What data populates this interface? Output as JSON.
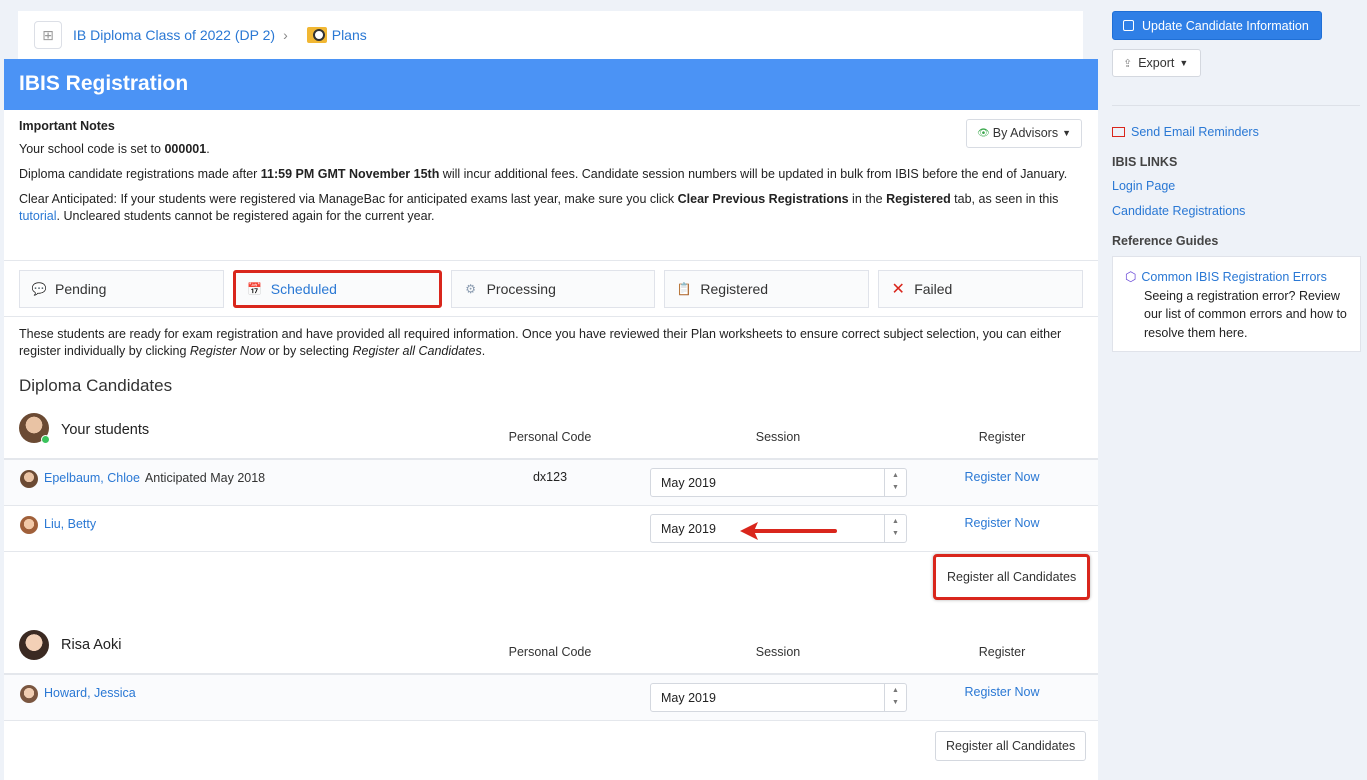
{
  "breadcrumb": {
    "class_name": "IB Diploma Class of 2022 (DP 2)",
    "separator": "›",
    "plans": "Plans"
  },
  "header": {
    "title": "IBIS Registration"
  },
  "notes": {
    "title": "Important Notes",
    "school_code_prefix": "Your school code is set to ",
    "school_code": "000001",
    "school_code_suffix": ".",
    "deadline_prefix": "Diploma candidate registrations made after ",
    "deadline": "11:59 PM GMT November 15th",
    "deadline_suffix": " will incur additional fees. Candidate session numbers will be updated in bulk from IBIS before the end of January.",
    "clear_prefix": "Clear Anticipated: If your students were registered via ManageBac for anticipated exams last year, make sure you click ",
    "clear_bold": "Clear Previous Registrations",
    "clear_mid": " in the ",
    "clear_tab": "Registered",
    "clear_mid2": " tab, as seen in this ",
    "tutorial_link": "tutorial",
    "clear_suffix": ". Uncleared students cannot be registered again for the current year.",
    "advisors_label": "By Advisors"
  },
  "tabs": [
    {
      "label": "Pending",
      "icon": "chat-bubble-icon"
    },
    {
      "label": "Scheduled",
      "icon": "calendar-icon"
    },
    {
      "label": "Processing",
      "icon": "gear-icon"
    },
    {
      "label": "Registered",
      "icon": "clipboard-check-icon"
    },
    {
      "label": "Failed",
      "icon": "x-icon"
    }
  ],
  "intro": {
    "p1": "These students are ready for exam registration and have provided all required information. Once you have reviewed their Plan worksheets to ensure correct subject selection, you can either register individually by clicking ",
    "register_now": "Register Now",
    "p2": " or by selecting ",
    "register_all": "Register all Candidates",
    "p3": "."
  },
  "section_title": "Diploma Candidates",
  "columns": {
    "code": "Personal Code",
    "session": "Session",
    "register": "Register"
  },
  "groups": [
    {
      "advisor": "Your students",
      "students": [
        {
          "name": "Epelbaum, Chloe",
          "note": "Anticipated May 2018",
          "code": "dx123",
          "session": "May 2019",
          "action": "Register Now"
        },
        {
          "name": "Liu, Betty",
          "note": "",
          "code": "",
          "session": "May 2019",
          "action": "Register Now"
        }
      ],
      "register_all": "Register all Candidates"
    },
    {
      "advisor": "Risa Aoki",
      "students": [
        {
          "name": "Howard, Jessica",
          "note": "",
          "code": "",
          "session": "May 2019",
          "action": "Register Now"
        }
      ],
      "register_all": "Register all Candidates"
    }
  ],
  "sidebar": {
    "update_button": "Update Candidate Information",
    "export_button": "Export",
    "send_reminders": "Send Email Reminders",
    "ibis_links_title": "IBIS LINKS",
    "login_page": "Login Page",
    "candidate_registrations": "Candidate Registrations",
    "reference_title": "Reference Guides",
    "guide_title": "Common IBIS Registration Errors",
    "guide_text": "Seeing a registration error? Review our list of common errors and how to resolve them here."
  },
  "colors": {
    "header": "#4b93f5",
    "link": "#2a78d4",
    "highlight": "#d9261c",
    "primary_button": "#2f7fe6"
  }
}
